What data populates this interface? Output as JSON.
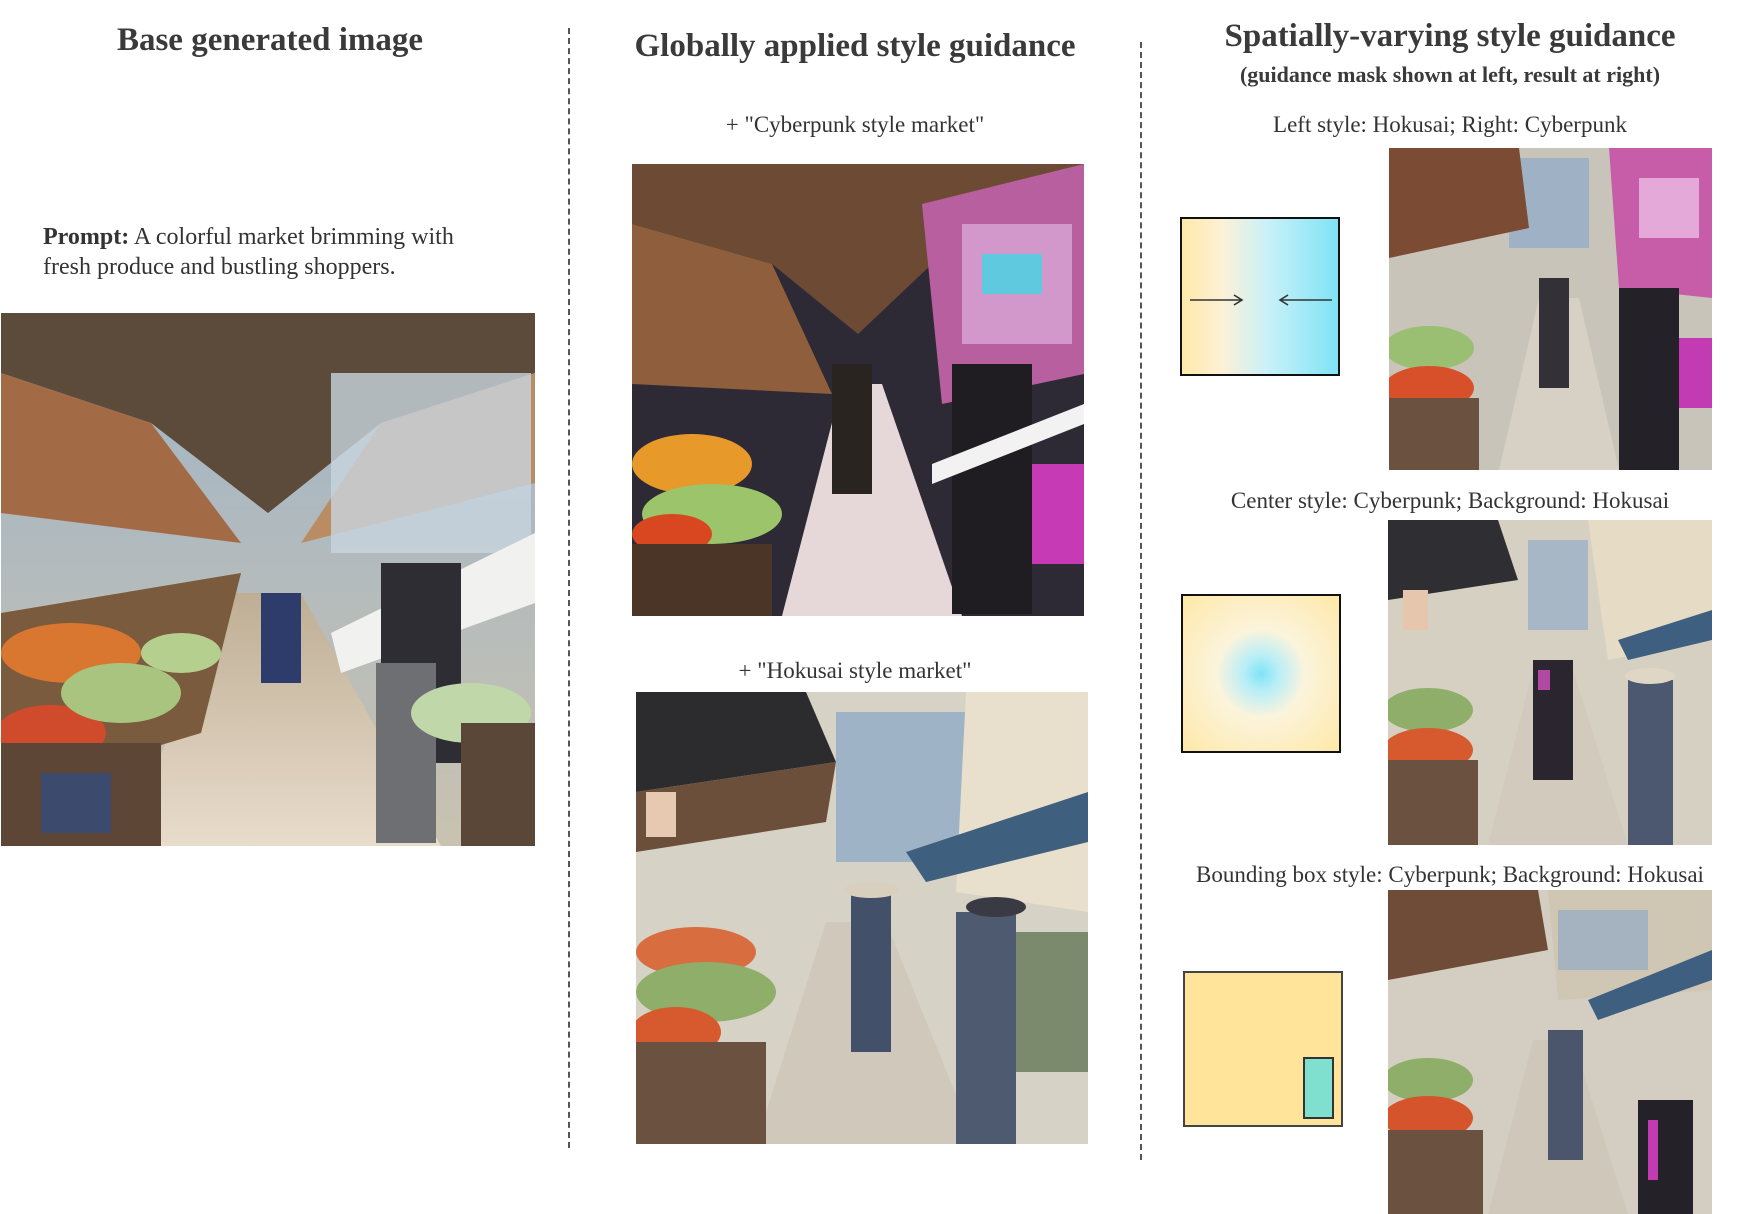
{
  "columns": {
    "base": {
      "title": "Base generated image",
      "prompt_label": "Prompt:",
      "prompt_text": "A colorful market brimming with fresh produce and bustling shoppers."
    },
    "global": {
      "title": "Globally applied style guidance",
      "captions": [
        "+ \"Cyberpunk style market\"",
        "+ \"Hokusai style market\""
      ]
    },
    "spatial": {
      "title": "Spatially-varying style guidance",
      "subtitle": "(guidance mask shown at left, result at right)",
      "rows": [
        {
          "caption": "Left style: Hokusai; Right: Cyberpunk"
        },
        {
          "caption": "Center style: Cyberpunk; Background: Hokusai"
        },
        {
          "caption": "Bounding box style: Cyberpunk; Background: Hokusai"
        }
      ]
    }
  },
  "colors": {
    "hokusai_mask": "#ffe8a8",
    "cyberpunk_mask": "#7fe3f5",
    "bbox_fill": "#7fe0d0"
  }
}
